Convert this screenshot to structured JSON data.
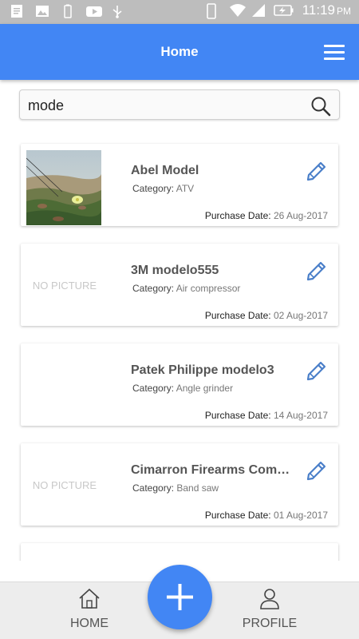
{
  "status_bar": {
    "time": "11:19",
    "ampm": "PM",
    "icons": [
      "notes-icon",
      "image-icon",
      "battery-saver-icon",
      "youtube-icon",
      "usb-icon",
      "phone-icon",
      "wifi-icon",
      "signal-icon",
      "battery-charging-icon"
    ]
  },
  "app_bar": {
    "title": "Home",
    "menu_icon": "hamburger-menu-icon"
  },
  "search": {
    "value": "mode",
    "icon": "search-icon"
  },
  "items": [
    {
      "name": "Abel Model",
      "category_label": "Category:",
      "category": "ATV",
      "date_label": "Purchase Date:",
      "date": "26 Aug-2017",
      "has_picture": true,
      "no_picture_text": ""
    },
    {
      "name": "3M modelo555",
      "category_label": "Category:",
      "category": "Air compressor",
      "date_label": "Purchase Date:",
      "date": "02 Aug-2017",
      "has_picture": false,
      "no_picture_text": "NO PICTURE"
    },
    {
      "name": "Patek Philippe modelo3",
      "category_label": "Category:",
      "category": "Angle grinder",
      "date_label": "Purchase Date:",
      "date": "14 Aug-2017",
      "has_picture": false,
      "no_picture_text": ""
    },
    {
      "name": "Cimarron Firearms Comp...",
      "category_label": "Category:",
      "category": "Band saw",
      "date_label": "Purchase Date:",
      "date": "01 Aug-2017",
      "has_picture": false,
      "no_picture_text": "NO PICTURE"
    }
  ],
  "bottom_nav": {
    "home_label": "HOME",
    "profile_label": "PROFILE",
    "fab_icon": "plus-icon"
  },
  "colors": {
    "primary": "#4286f4",
    "status_bar": "#bdbdbd",
    "edit_icon": "#4a7fc9"
  }
}
